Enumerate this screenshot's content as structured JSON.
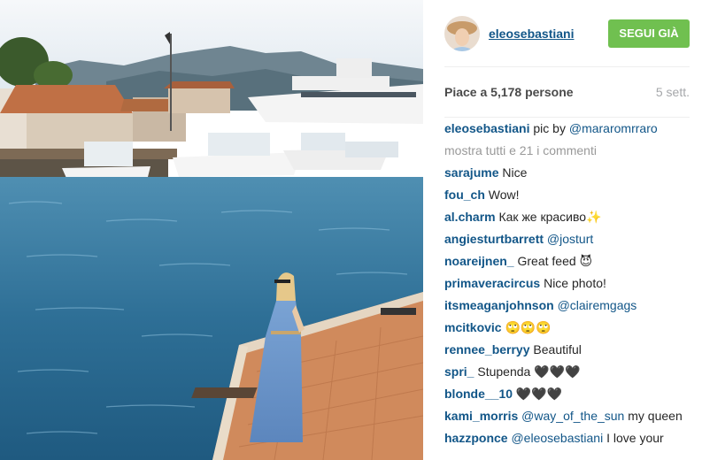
{
  "post": {
    "username": "eleosebastiani",
    "follow_label": "SEGUI GIÀ",
    "likes_text": "Piace a 5,178 persone",
    "time_ago": "5 sett.",
    "caption": {
      "user": "eleosebastiani",
      "text": " pic by ",
      "mention": "@mararomrraro"
    },
    "show_all_comments": "mostra tutti e 21 i commenti"
  },
  "comments": [
    {
      "user": "sarajume",
      "text": " Nice"
    },
    {
      "user": "fou_ch",
      "text": " Wow!"
    },
    {
      "user": "al.charm",
      "text": " Как же красиво✨"
    },
    {
      "user": "angiesturtbarrett",
      "mention": " @josturt"
    },
    {
      "user": "noareijnen_",
      "text": " Great feed 😈"
    },
    {
      "user": "primaveracircus",
      "text": " Nice photo!"
    },
    {
      "user": "itsmeaganjohnson",
      "mention": " @clairemgags"
    },
    {
      "user": "mcitkovic",
      "text": " 🙄🙄🙄"
    },
    {
      "user": "rennee_berryy",
      "text": " Beautiful"
    },
    {
      "user": "spri_",
      "text": " Stupenda 🖤🖤🖤"
    },
    {
      "user": "blonde__10",
      "text": " 🖤🖤🖤"
    },
    {
      "user": "kami_morris",
      "mention": " @way_of_the_sun",
      "text": " my queen"
    },
    {
      "user": "hazzponce",
      "mention": " @eleosebastiani",
      "text": " I love your"
    }
  ],
  "colors": {
    "link": "#125688",
    "follow_button": "#70c050",
    "muted": "#a5a7aa"
  }
}
